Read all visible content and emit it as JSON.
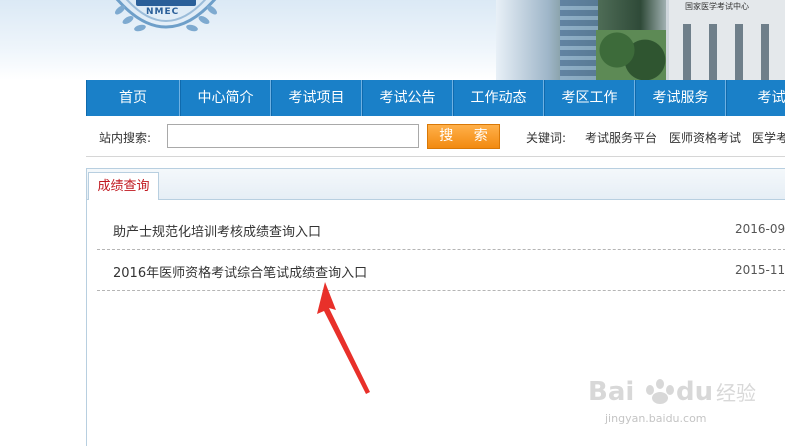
{
  "header": {
    "logo_text": "NMEC",
    "building_sign": "国家医学考试中心"
  },
  "nav": {
    "items": [
      "首页",
      "中心简介",
      "考试项目",
      "考试公告",
      "工作动态",
      "考区工作",
      "考试服务",
      "考试"
    ]
  },
  "search": {
    "label": "站内搜索:",
    "input_value": "",
    "button_label": "搜 索",
    "keywords_label": "关键词:",
    "keywords": [
      "考试服务平台",
      "医师资格考试",
      "医学考"
    ]
  },
  "panel": {
    "tab_label": "成绩查询",
    "items": [
      {
        "title": "助产士规范化培训考核成绩查询入口",
        "date": "2016-09-"
      },
      {
        "title": "2016年医师资格考试综合笔试成绩查询入口",
        "date": "2015-11-"
      }
    ]
  },
  "watermark": {
    "text": "jingyan.baidu.com"
  },
  "colors": {
    "nav_bg": "#1a80c8",
    "search_button": "#f28a10",
    "tab_text": "#c0181f",
    "arrow": "#e8302a"
  }
}
